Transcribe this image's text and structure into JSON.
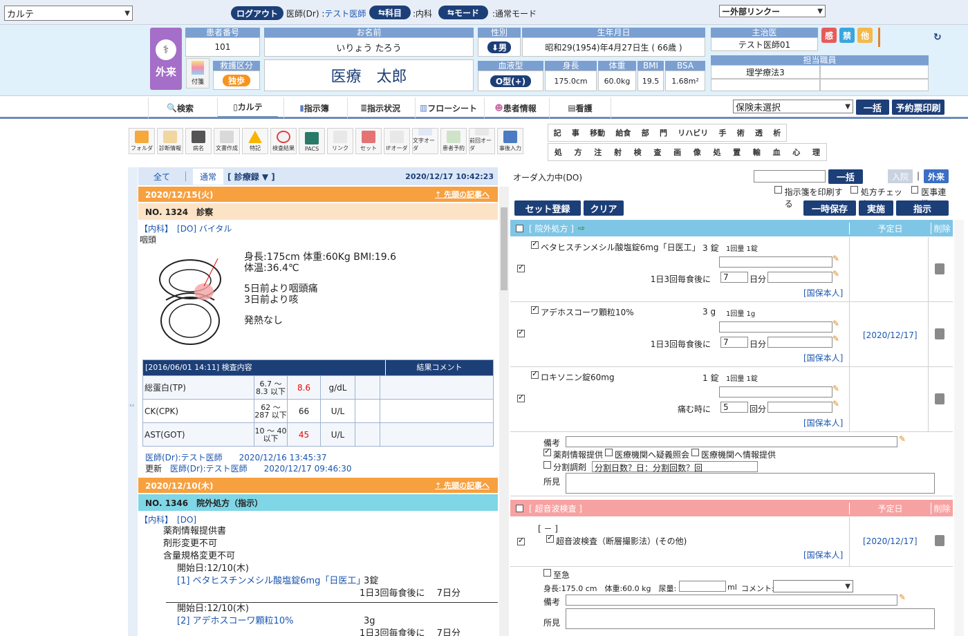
{
  "topbar": {
    "screen_select": "カルテ",
    "logout": "ログアウト",
    "doctor_label": "医師(Dr)",
    "doctor_name": "テスト医師",
    "dept_btn": "科目",
    "dept_val": ":内科",
    "mode_btn": "モード",
    "mode_val": ":通常モード",
    "ext_link": "ー外部リンクー"
  },
  "patient": {
    "mode_badge": "外来",
    "sticky_label": "付箋",
    "id_h": "患者番号",
    "id": "101",
    "name_h": "お名前",
    "kana": "いりょう たろう",
    "name": "医療　太郎",
    "sex_h": "性別",
    "sex": "男",
    "dob_h": "生年月日",
    "dob": "昭和29(1954)年4月27日生 ( 66歳 )",
    "triage_h": "救護区分",
    "triage": "独歩",
    "blood_h": "血液型",
    "blood": "O型(+)",
    "height_h": "身長",
    "height": "175.0cm",
    "weight_h": "体重",
    "weight": "60.0kg",
    "bmi_h": "BMI",
    "bmi": "19.5",
    "bsa_h": "BSA",
    "bsa": "1.68m²",
    "doctor_h": "主治医",
    "doctor": "テスト医師01",
    "staff_h": "担当職員",
    "staff": "理学療法3",
    "flag1": "感",
    "flag2": "禁",
    "flag3": "他"
  },
  "nav": {
    "tabs": [
      "検索",
      "カルテ",
      "指示簿",
      "指示状況",
      "フローシート",
      "患者情報",
      "看護"
    ],
    "insurance": "保険未選択",
    "bulk": "一括",
    "print": "予約票印刷"
  },
  "tools": [
    "フォルダ",
    "診断情報",
    "病名",
    "文書作成",
    "特記",
    "検査結果",
    "PACS",
    "リンク",
    "セット",
    "IFオーダ",
    "文字オーダ",
    "患者予約",
    "前回オーダ",
    "事後入力"
  ],
  "order_grid": {
    "row1": [
      "記",
      "事",
      "移動",
      "給食",
      "部",
      "門",
      "リハビリ",
      "手",
      "術",
      "透",
      "析"
    ],
    "row2": [
      "処",
      "方",
      "注",
      "射",
      "検",
      "査",
      "画",
      "像",
      "処",
      "置",
      "輸",
      "血",
      "心",
      "理"
    ]
  },
  "left": {
    "filter_all": "全て",
    "filter_normal": "通常",
    "filter_record": "[ 診療録 ▼ ]",
    "timestamp": "2020/12/17 10:42:23",
    "entry1_date": "2020/12/15(火)",
    "goto_top": "先頭の記事へ",
    "entry1_no": "NO. 1324　診察",
    "entry1_dept": "【内科】",
    "entry1_do": "[DO] バイタル",
    "entry1_sub": "咽頭",
    "vitals1": "身長:175cm 体重:60Kg BMI:19.6",
    "vitals2": "体温:36.4℃",
    "note1": "5日前より咽頭痛",
    "note2": "3日前より咳",
    "note3": "発熱なし",
    "lab_head": "[2016/06/01 14:11]  検査内容",
    "lab_comment": "結果コメント",
    "labs": [
      {
        "name": "総蛋白(TP)",
        "range": "6.7 〜 8.3 以下",
        "value": "8.6",
        "unit": "g/dL",
        "high": true
      },
      {
        "name": "CK(CPK)",
        "range": "62 〜 287 以下",
        "value": "66",
        "unit": "U/L",
        "high": false
      },
      {
        "name": "AST(GOT)",
        "range": "10 〜 40 以下",
        "value": "45",
        "unit": "U/L",
        "high": true
      }
    ],
    "sign1": "医師(Dr):テスト医師　　2020/12/16 13:45:37",
    "sign2_label": "更新",
    "sign2": "医師(Dr):テスト医師　　2020/12/17 09:46:30",
    "entry2_date": "2020/12/10(木)",
    "entry2_no": "NO. 1346　院外処方（指示）",
    "entry2_dept": "【内科】",
    "entry2_do": "[DO]",
    "e2_l1": "薬剤情報提供書",
    "e2_l2": "剤形変更不可",
    "e2_l3": "含量規格変更不可",
    "e2_start1": "開始日:12/10(木)",
    "e2_rx1": "[1] ベタヒスチンメシル酸塩錠6mg「日医工」",
    "e2_rx1_qty": "3錠",
    "e2_rx1_sig": "1日3回毎食後に　 7日分",
    "e2_start2": "開始日:12/10(木)",
    "e2_rx2": "[2] アデホスコーワ顆粒10%",
    "e2_rx2_qty": "3g",
    "e2_rx2_sig": "1日3回毎食後に　 7日分"
  },
  "right": {
    "status": "オーダ入力中(DO)",
    "bulk": "一括",
    "inpatient": "入院",
    "outpatient": "外来",
    "print_chk": "指示箋を印刷する",
    "rx_check": "処方チェック",
    "med_link": "医事連携",
    "set_reg": "セット登録",
    "clear": "クリア",
    "temp_save": "一時保存",
    "execute": "実施",
    "instruct": "指示",
    "sec1": "[ 院外処方 ]",
    "due_h": "予定日",
    "del_h": "削除",
    "drugs": [
      {
        "name": "ベタヒスチンメシル酸塩錠6mg「日医工」",
        "qty": "3 錠",
        "dose": "1回量 1錠",
        "sig": "1日3回毎食後に",
        "days": "7",
        "unit": "日分",
        "ins": "[国保本人]"
      },
      {
        "name": "アデホスコーワ顆粒10%",
        "qty": "3 g",
        "dose": "1回量 1g",
        "sig": "1日3回毎食後に",
        "days": "7",
        "unit": "日分",
        "ins": "[国保本人]"
      },
      {
        "name": "ロキソニン錠60mg",
        "qty": "1 錠",
        "dose": "1回量 1錠",
        "sig": "痛む時に",
        "days": "5",
        "unit": "回分",
        "ins": "[国保本人]"
      }
    ],
    "due1": "[2020/12/17]",
    "memo": "備考",
    "c1": "薬剤情報提供",
    "c2": "医療機関へ疑義照会",
    "c3": "医療機関へ情報提供",
    "split": "分割調剤",
    "split_val": "分割日数？日：分割回数？回",
    "finding": "所見",
    "sec2": "[ 超音波検査 ]",
    "us_bracket": "[ － ]",
    "us_item": "超音波検査（断層撮影法）(その他)",
    "us_ins": "[国保本人]",
    "due2": "[2020/12/17]",
    "urgent": "至急",
    "us_vitals": "身長:175.0 cm　体重:60.0 kg　尿量:",
    "ml": "ml",
    "comment": "コメント:"
  }
}
